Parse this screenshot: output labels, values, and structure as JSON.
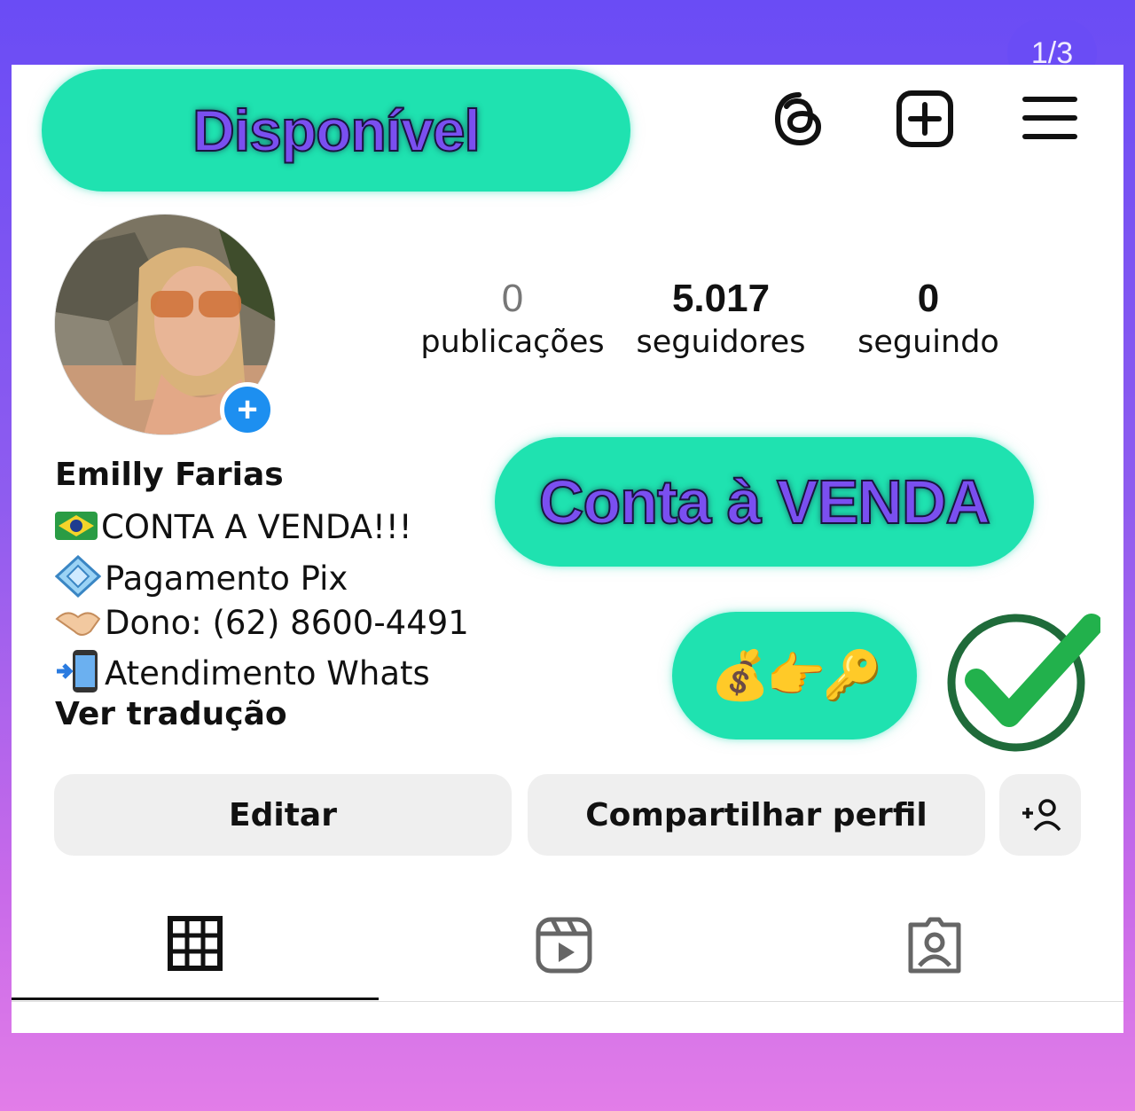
{
  "badge_available": "Disponível",
  "pager": "1/3",
  "header_icons": [
    "threads-icon",
    "create-post-icon",
    "menu-icon"
  ],
  "stats": [
    {
      "value": "0",
      "label": "publicações"
    },
    {
      "value": "5.017",
      "label": "seguidores"
    },
    {
      "value": "0",
      "label": "seguindo"
    }
  ],
  "profile": {
    "name": "Emilly Farias",
    "bio": [
      {
        "icon": "brazil-flag",
        "text": "CONTA A VENDA!!!"
      },
      {
        "icon": "pix-icon",
        "text": "Pagamento Pix"
      },
      {
        "icon": "handshake-icon",
        "text": "Dono: (62) 8600-4491"
      },
      {
        "icon": "phone-arrow-icon",
        "text": "Atendimento Whats"
      }
    ],
    "translate": "Ver tradução"
  },
  "sale_banner": "Conta à VENDA",
  "sale_emoji": "💰👉🔑",
  "buttons": {
    "edit": "Editar",
    "share": "Compartilhar perfil"
  },
  "tabs": [
    "grid-icon",
    "reels-icon",
    "tagged-icon"
  ],
  "colors": {
    "accent_teal": "#1fe2b0",
    "accent_purple": "#7a4ff0",
    "check_green": "#22b14c"
  }
}
